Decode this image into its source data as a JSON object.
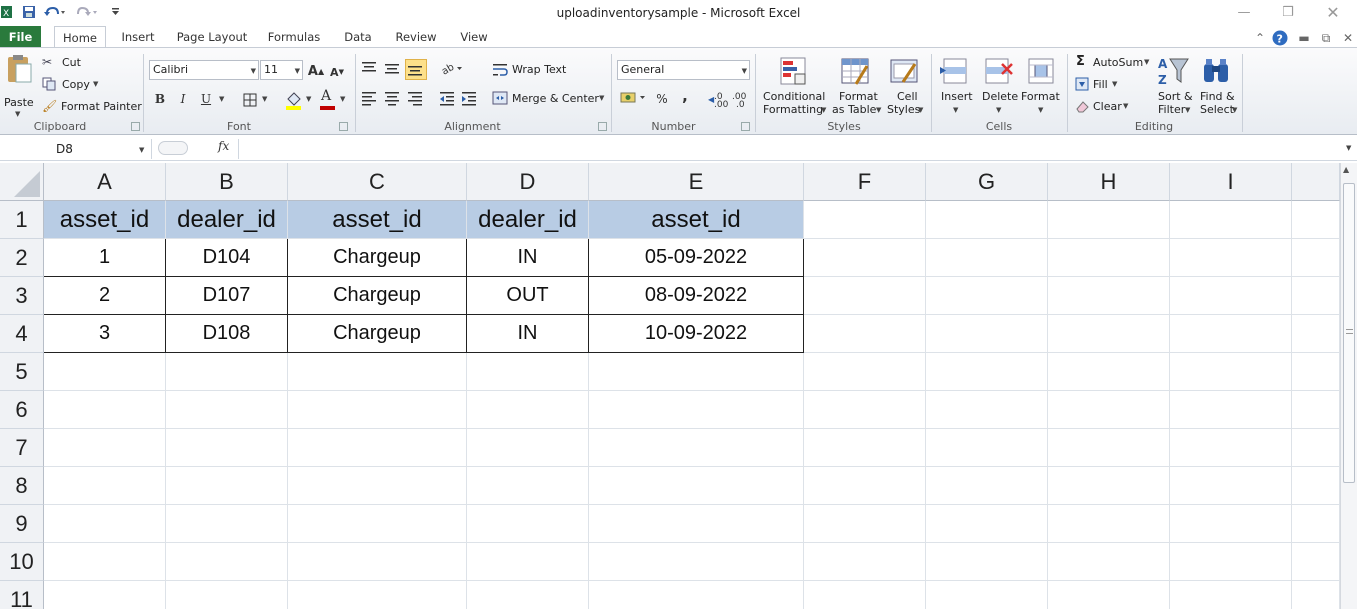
{
  "window": {
    "title": "uploadinventorysample  -  Microsoft Excel"
  },
  "ribbon_tabs": [
    "File",
    "Home",
    "Insert",
    "Page Layout",
    "Formulas",
    "Data",
    "Review",
    "View"
  ],
  "clipboard": {
    "paste": "Paste",
    "cut": "Cut",
    "copy": "Copy",
    "format_painter": "Format Painter",
    "group": "Clipboard"
  },
  "font": {
    "name": "Calibri",
    "size": "11",
    "bold": "B",
    "italic": "I",
    "underline": "U",
    "grow": "A",
    "shrink": "A",
    "color_letter": "A",
    "font_color": "#c00000",
    "fill_color": "#ffff00",
    "group": "Font"
  },
  "alignment": {
    "wrap_text": "Wrap Text",
    "merge_center": "Merge & Center",
    "group": "Alignment"
  },
  "number": {
    "format": "General",
    "percent": "%",
    "comma": ",",
    "inc_decimal": ".00",
    "dec_decimal": ".0",
    "group": "Number"
  },
  "styles": {
    "conditional_1": "Conditional",
    "conditional_2": "Formatting",
    "format_table_1": "Format",
    "format_table_2": "as Table",
    "cell_styles_1": "Cell",
    "cell_styles_2": "Styles",
    "group": "Styles"
  },
  "cells": {
    "insert": "Insert",
    "delete": "Delete",
    "format": "Format",
    "group": "Cells"
  },
  "editing": {
    "autosum": "AutoSum",
    "sigma": "Σ",
    "fill": "Fill",
    "clear": "Clear",
    "sort_1": "Sort &",
    "sort_2": "Filter",
    "find_1": "Find &",
    "find_2": "Select",
    "group": "Editing"
  },
  "formula_bar": {
    "name_box": "D8",
    "fx": "fx",
    "formula": ""
  },
  "sheet": {
    "columns": [
      "A",
      "B",
      "C",
      "D",
      "E",
      "F",
      "G",
      "H",
      "I"
    ],
    "rows": [
      "1",
      "2",
      "3",
      "4",
      "5",
      "6",
      "7",
      "8",
      "9",
      "10",
      "11"
    ],
    "header_fill": "#b8cce4",
    "header": [
      "asset_id",
      "dealer_id",
      "asset_id",
      "dealer_id",
      "asset_id"
    ],
    "data": [
      [
        "1",
        "D104",
        "Chargeup",
        "IN",
        "05-09-2022"
      ],
      [
        "2",
        "D107",
        "Chargeup",
        "OUT",
        "08-09-2022"
      ],
      [
        "3",
        "D108",
        "Chargeup",
        "IN",
        "10-09-2022"
      ]
    ]
  },
  "icons": [
    "excel-logo-icon",
    "save-icon",
    "undo-icon",
    "redo-icon",
    "customize-qat-icon",
    "minimize-icon",
    "restore-icon",
    "close-icon",
    "help-icon",
    "ribbon-collapse-icon"
  ]
}
